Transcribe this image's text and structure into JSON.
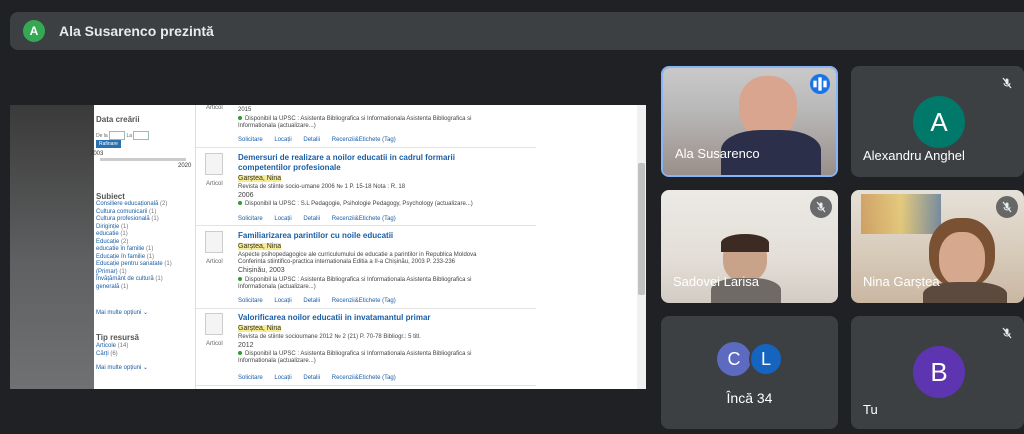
{
  "presenter": {
    "avatar_letter": "A",
    "title": "Ala Susarenco prezintă",
    "avatar_color": "#34a853"
  },
  "shared_screen": {
    "sidebar": {
      "date_heading": "Data creării",
      "from_label": "De la",
      "to_label": "La",
      "apply_button": "Rafinare",
      "year_from": "2003",
      "year_to": "2020",
      "subject_heading": "Subiect",
      "subjects": [
        {
          "label": "Consiliere educațională",
          "count": "(2)"
        },
        {
          "label": "Cultura comunicarii",
          "count": "(1)"
        },
        {
          "label": "Cultura profesională",
          "count": "(1)"
        },
        {
          "label": "Diriginție",
          "count": "(1)"
        },
        {
          "label": "educatie",
          "count": "(1)"
        },
        {
          "label": "Educație",
          "count": "(2)"
        },
        {
          "label": "educatie în familie",
          "count": "(1)"
        },
        {
          "label": "Educație în familie",
          "count": "(1)"
        },
        {
          "label": "Educație pentru sanatate",
          "count": "(1)"
        },
        {
          "label": "(Primar)",
          "count": "(1)"
        },
        {
          "label": "Învățământ de cultură",
          "count": "(1)"
        },
        {
          "label": "generală",
          "count": "(1)"
        }
      ],
      "more_options_1": "Mai multe opțiuni",
      "resource_heading": "Tip resursă",
      "resources": [
        {
          "label": "Articole",
          "count": "(14)"
        },
        {
          "label": "Cărți",
          "count": "(6)"
        }
      ],
      "more_options_2": "Mai multe opțiuni"
    },
    "results": [
      {
        "kind": "Articol",
        "title": "",
        "author": "",
        "desc": "",
        "desc2": "",
        "year": "2015",
        "avail": "Disponibil la UPSC : Asistenta Bibliografica si Informationala  Asistenta Bibliografica si",
        "avail2": "Informationala  (actualizare...)",
        "actions": [
          "Solicitare",
          "Locații",
          "Detalii",
          "Recenzii&Etichete (Tag)"
        ]
      },
      {
        "kind": "Articol",
        "title": "Demersuri de realizare a noilor educatii in cadrul formarii competentilor profesionale",
        "author": "Garștea, Nina",
        "desc": "Revista de stiinte socio-umane 2006 № 1 P. 15-18 Nota : R. 18",
        "desc2": "",
        "year": "2006",
        "avail": "Disponibil la UPSC : S.L Pedagogie, Psihologie  Pedagogy, Psychology  (actualizare...)",
        "avail2": "",
        "actions": [
          "Solicitare",
          "Locații",
          "Detalii",
          "Recenzii&Etichete (Tag)"
        ]
      },
      {
        "kind": "Articol",
        "title": "Familiarizarea parintilor cu noile educatii",
        "author": "Garștea, Nina",
        "desc": "Aspecte psihopedagogice ale curriculumului de educatie a parintilor in Republica Moldova",
        "desc2": "Conferinta stiintifico-practica internationala Editia a II-a Chișinău, 2003 P. 233-236",
        "year": "Chișinău, 2003",
        "avail": "Disponibil la UPSC : Asistenta Bibliografica si Informationala  Asistenta Bibliografica si",
        "avail2": "Informationala  (actualizare...)",
        "actions": [
          "Solicitare",
          "Locații",
          "Detalii",
          "Recenzii&Etichete (Tag)"
        ]
      },
      {
        "kind": "Articol",
        "title": "Valorificarea noilor educatii in invatamantul primar",
        "author": "Garștea, Nina",
        "desc": "Revista de stiinte socioumane 2012 № 2 (21) P. 70-78 Bibliogr.: 5 titl.",
        "desc2": "",
        "year": "2012",
        "avail": "Disponibil la UPSC : Asistenta Bibliografica si Informationala  Asistenta Bibliografica si",
        "avail2": "Informationala  (actualizare...)",
        "actions": [
          "Solicitare",
          "Locații",
          "Detalii",
          "Recenzii&Etichete (Tag)"
        ]
      }
    ]
  },
  "participants": {
    "ala": {
      "name": "Ala Susarenco"
    },
    "alexandru": {
      "name": "Alexandru Anghel",
      "letter": "A",
      "color": "#00796b"
    },
    "sadovei": {
      "name": "Sadovei Larisa"
    },
    "nina": {
      "name": "Nina Garștea"
    },
    "more": {
      "label": "Încă 34",
      "letter1": "C",
      "letter2": "L",
      "color1": "#5c6bc0",
      "color2": "#1565c0"
    },
    "you": {
      "name": "Tu",
      "letter": "B",
      "color": "#5e35b1"
    }
  }
}
